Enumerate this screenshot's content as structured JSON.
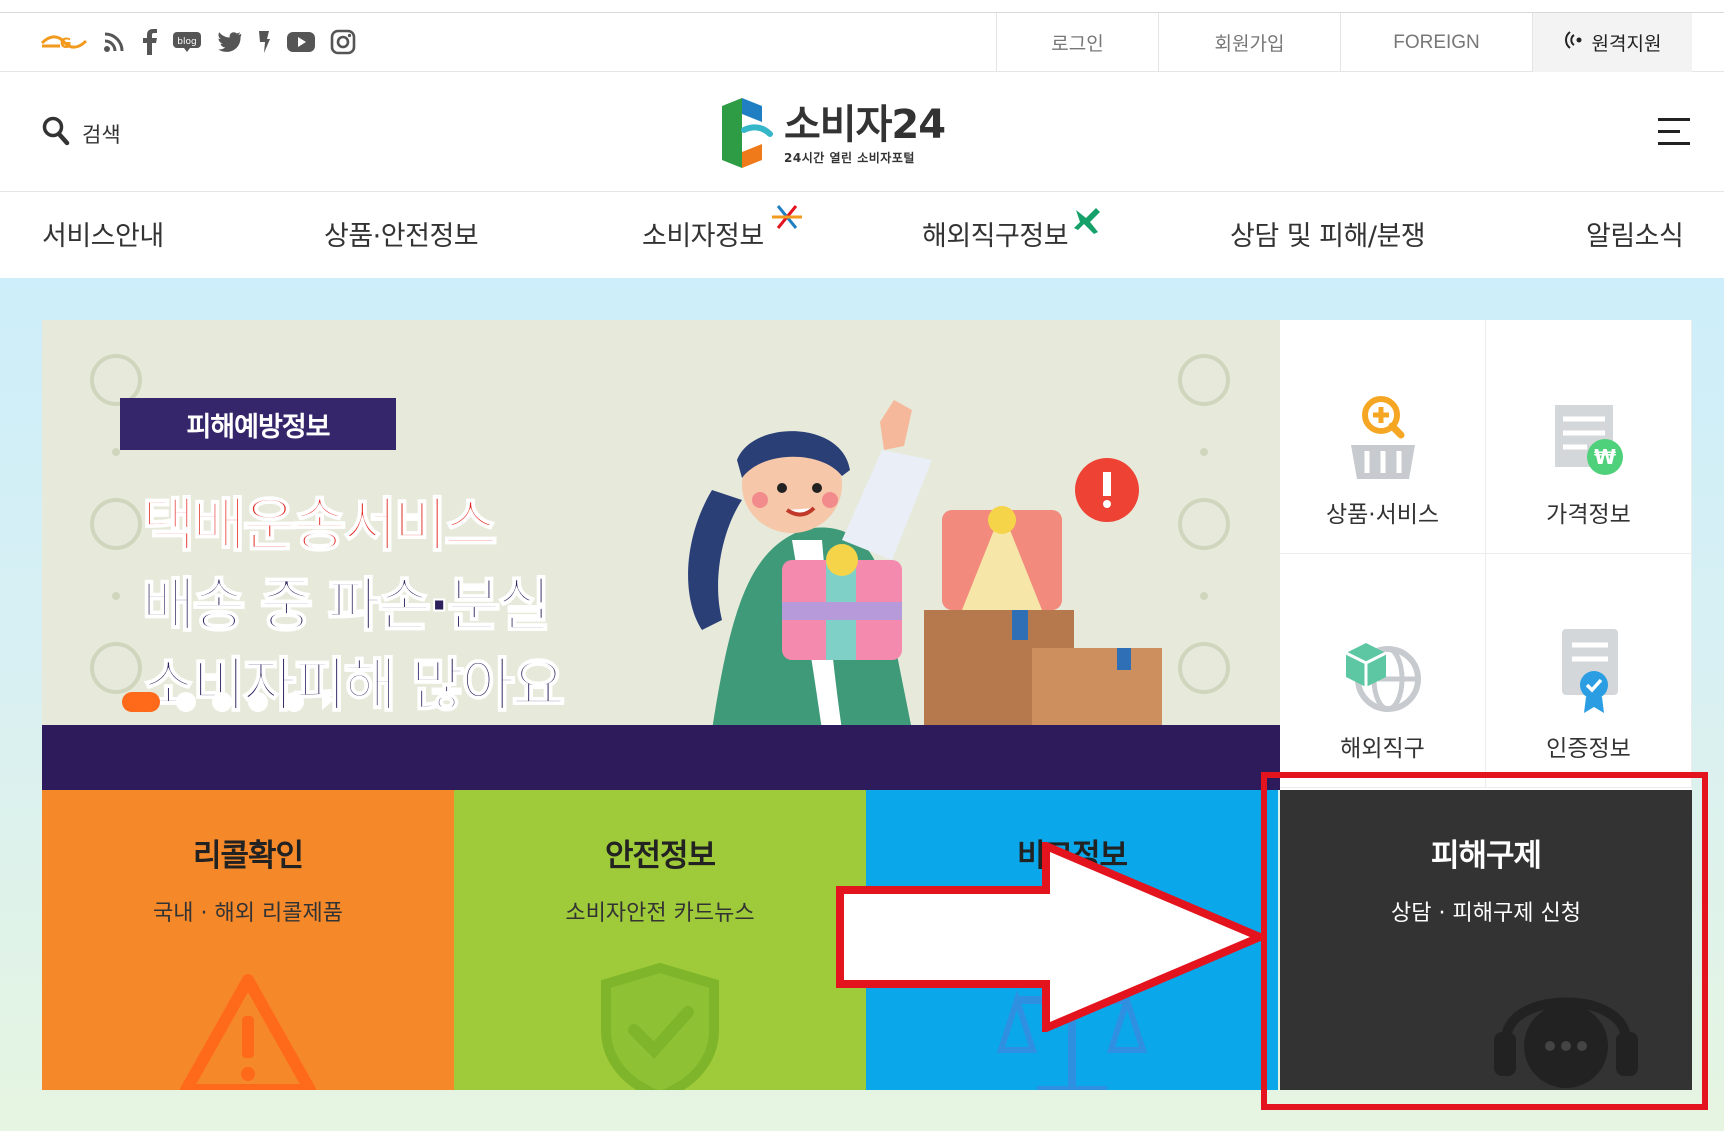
{
  "social": {
    "icons": [
      "eg-logo-icon",
      "rss-icon",
      "facebook-icon",
      "blog-icon",
      "twitter-icon",
      "kakao-story-icon",
      "youtube-icon",
      "instagram-icon"
    ],
    "blog_label": "blog"
  },
  "util": {
    "login": "로그인",
    "signup": "회원가입",
    "foreign": "FOREIGN",
    "remote": "원격지원"
  },
  "header": {
    "search_label": "검색",
    "logo_title": "소비자24",
    "logo_sub": "24시간 열린 소비자포털"
  },
  "gnb": [
    "서비스안내",
    "상품·안전정보",
    "소비자정보",
    "해외직구정보",
    "상담 및 피해/분쟁",
    "알림소식"
  ],
  "banner": {
    "tag": "피해예방정보",
    "line1": "택배운송서비스",
    "line2": "배송 중 파손·분실",
    "line3": "소비자피해 많아요",
    "slide_count": 5,
    "active_slide": 1
  },
  "tiles": [
    {
      "label": "상품·서비스",
      "icon": "basket-search-icon"
    },
    {
      "label": "가격정보",
      "icon": "price-document-icon"
    },
    {
      "label": "해외직구",
      "icon": "globe-box-icon"
    },
    {
      "label": "인증정보",
      "icon": "certificate-icon"
    }
  ],
  "quick": [
    {
      "title": "리콜확인",
      "sub": "국내 · 해외 리콜제품",
      "color": "#f5892a"
    },
    {
      "title": "안전정보",
      "sub": "소비자안전 카드뉴스",
      "color": "#9fcb3a"
    },
    {
      "title": "비교정보",
      "sub": "",
      "color": "#0aa8ea"
    },
    {
      "title": "피해구제",
      "sub": "상담 · 피해구제 신청",
      "color": "#333333"
    }
  ],
  "colors": {
    "highlight": "#e3141e",
    "accent_orange": "#ff6a1a",
    "banner_purple": "#2e1b5c"
  }
}
